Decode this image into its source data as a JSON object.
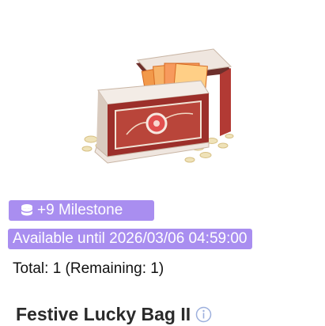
{
  "item": {
    "image_icon": "chest-icon",
    "milestone_icon": "coin-stack-icon",
    "milestone_label": "+9 Milestone",
    "availability_label": "Available until 2026/03/06 04:59:00",
    "total_label": "Total: 1 (Remaining: 1)",
    "title": "Festive Lucky Bag II",
    "info_icon": "info-icon"
  },
  "colors": {
    "badge_bg": "#a98ef0",
    "badge_text": "#ffffff",
    "info_icon": "#9db0dd"
  }
}
